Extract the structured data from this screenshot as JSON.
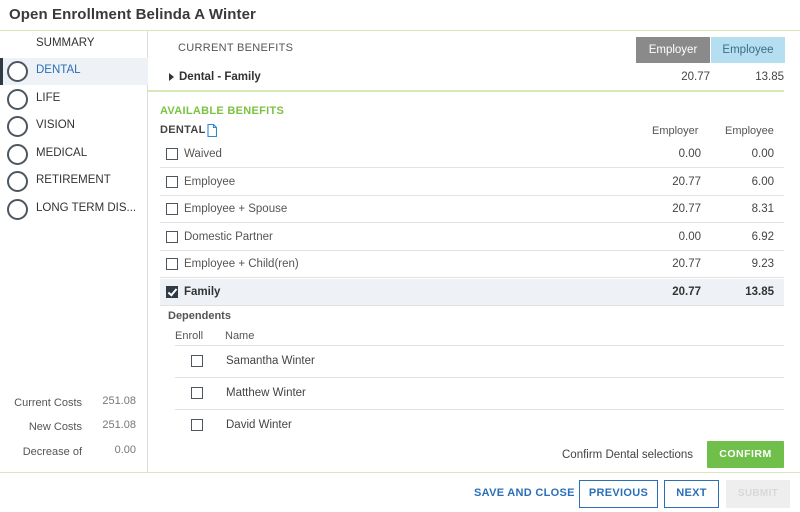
{
  "header": {
    "title": "Open Enrollment Belinda A Winter"
  },
  "sidebar": {
    "summary_label": "SUMMARY",
    "items": [
      {
        "label": "DENTAL",
        "active": true
      },
      {
        "label": "LIFE",
        "active": false
      },
      {
        "label": "VISION",
        "active": false
      },
      {
        "label": "MEDICAL",
        "active": false
      },
      {
        "label": "RETIREMENT",
        "active": false
      },
      {
        "label": "LONG TERM DIS...",
        "active": false
      }
    ],
    "costs": [
      {
        "label": "Current Costs",
        "value": "251.08"
      },
      {
        "label": "New Costs",
        "value": "251.08"
      },
      {
        "label": "Decrease of",
        "value": "0.00"
      }
    ]
  },
  "current_benefits": {
    "heading": "CURRENT BENEFITS",
    "employer_label": "Employer",
    "employee_label": "Employee",
    "row": {
      "name": "Dental - Family",
      "employer": "20.77",
      "employee": "13.85"
    }
  },
  "available_benefits": {
    "heading": "AVAILABLE BENEFITS",
    "section": "DENTAL",
    "employer_label": "Employer",
    "employee_label": "Employee",
    "options": [
      {
        "name": "Waived",
        "employer": "0.00",
        "employee": "0.00",
        "checked": false
      },
      {
        "name": "Employee",
        "employer": "20.77",
        "employee": "6.00",
        "checked": false
      },
      {
        "name": "Employee + Spouse",
        "employer": "20.77",
        "employee": "8.31",
        "checked": false
      },
      {
        "name": "Domestic Partner",
        "employer": "0.00",
        "employee": "6.92",
        "checked": false
      },
      {
        "name": "Employee + Child(ren)",
        "employer": "20.77",
        "employee": "9.23",
        "checked": false
      },
      {
        "name": "Family",
        "employer": "20.77",
        "employee": "13.85",
        "checked": true
      }
    ]
  },
  "dependents": {
    "title": "Dependents",
    "enroll_header": "Enroll",
    "name_header": "Name",
    "rows": [
      {
        "name": "Samantha Winter",
        "checked": false
      },
      {
        "name": "Matthew Winter",
        "checked": false
      },
      {
        "name": "David Winter",
        "checked": false
      }
    ]
  },
  "confirm": {
    "text": "Confirm Dental selections",
    "button": "CONFIRM"
  },
  "footer": {
    "save_close": "SAVE AND CLOSE",
    "previous": "PREVIOUS",
    "next": "NEXT",
    "submit": "SUBMIT"
  },
  "colors": {
    "accent_green": "#7cc242",
    "confirm_green": "#6fbf4a",
    "link_blue": "#2a6fb8",
    "employer_header": "#8a8a8a",
    "employee_header": "#b5dff1"
  }
}
